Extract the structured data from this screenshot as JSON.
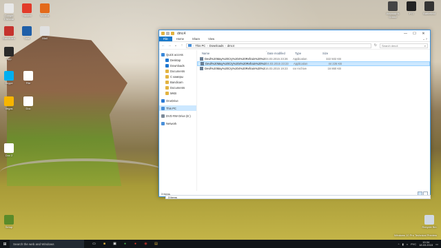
{
  "desktop": {
    "icons": [
      {
        "label": "Google Chrome",
        "color": "#e8e8e8"
      },
      {
        "label": "Yandex",
        "color": "#e23b2a"
      },
      {
        "label": "Mozilla",
        "color": "#e36a1b"
      },
      {
        "label": "Bandicam",
        "color": "#c5332d"
      },
      {
        "label": "Total",
        "color": "#1f5fa8"
      },
      {
        "label": "Mail",
        "color": "#e0e0e0"
      },
      {
        "label": "App",
        "color": "#2a2a2a"
      },
      {
        "label": "Skype",
        "color": "#00aff0"
      },
      {
        "label": "Vegas",
        "color": "#f7b500"
      },
      {
        "label": "File",
        "color": "#ffffff"
      },
      {
        "label": "Doc",
        "color": "#ffffff"
      },
      {
        "label": "Doc 2",
        "color": "#ffffff"
      },
      {
        "label": "Setup",
        "color": "#5a8b2a"
      },
      {
        "label": "Recycle Bin",
        "color": "#cfd8e3"
      }
    ],
    "top_right_icons": [
      {
        "label": "Assassin's Creed",
        "color": "#444"
      },
      {
        "label": "PTI",
        "color": "#222"
      },
      {
        "label": "Battlefield",
        "color": "#333"
      }
    ],
    "watermark": "Windows 10 Pro Technical Preview"
  },
  "explorer": {
    "title": "dmc4",
    "window_controls": [
      "—",
      "☐",
      "✕"
    ],
    "ribbon_tabs": [
      "File",
      "Home",
      "Share",
      "View"
    ],
    "address_crumbs": [
      "This PC",
      "Downloads",
      "dmc4"
    ],
    "search_placeholder": "Search dmc4",
    "nav_pane": [
      {
        "label": "Quick access",
        "sub": false,
        "selected": false,
        "icon_color": "#3a88d9"
      },
      {
        "label": "Desktop",
        "sub": true,
        "selected": false,
        "icon_color": "#1f77d0"
      },
      {
        "label": "Downloads",
        "sub": true,
        "selected": false,
        "icon_color": "#1f77d0"
      },
      {
        "label": "Documents",
        "sub": true,
        "selected": false,
        "icon_color": "#e3b341"
      },
      {
        "label": "С камеры",
        "sub": true,
        "selected": false,
        "icon_color": "#e3b341"
      },
      {
        "label": "Bandicam",
        "sub": true,
        "selected": false,
        "icon_color": "#e3b341"
      },
      {
        "label": "Documents",
        "sub": true,
        "selected": false,
        "icon_color": "#e3b341"
      },
      {
        "label": "MKB",
        "sub": true,
        "selected": false,
        "icon_color": "#e3b341"
      },
      {
        "label": "OneDrive",
        "sub": false,
        "selected": false,
        "icon_color": "#2a7ad6"
      },
      {
        "label": "This PC",
        "sub": false,
        "selected": true,
        "icon_color": "#4a90d9"
      },
      {
        "label": "DVD RW Drive (E:)",
        "sub": false,
        "selected": false,
        "icon_color": "#7b8a99"
      },
      {
        "label": "Network",
        "sub": false,
        "selected": false,
        "icon_color": "#4a90d9"
      }
    ],
    "columns": {
      "name": "Name",
      "date": "Date modified",
      "type": "Type",
      "size": "Size"
    },
    "files": [
      {
        "name": "Devil%20May%20Cry%204%20Refrain%20%28sound%29",
        "date": "04.03.2015 23:26",
        "type": "Application",
        "size": "322 502 KB",
        "selected": false
      },
      {
        "name": "Devil%20May%20Cry%204%20Refrain%20%28text%29",
        "date": "04.03.2015 23:23",
        "type": "Application",
        "size": "44 226 KB",
        "selected": true
      },
      {
        "name": "Devil%20May%20Cry%204%20Refrain%20%28original%29",
        "date": "16.03.2015 19:23",
        "type": "rar Archive",
        "size": "16 860 KB",
        "selected": false
      }
    ],
    "status_items": "3 items",
    "status_items_outer": "3 items"
  },
  "taskbar": {
    "search_placeholder": "Search the web and Windows",
    "tray_lang": "РУС",
    "time": "19:34",
    "date": "18.03.2015"
  }
}
